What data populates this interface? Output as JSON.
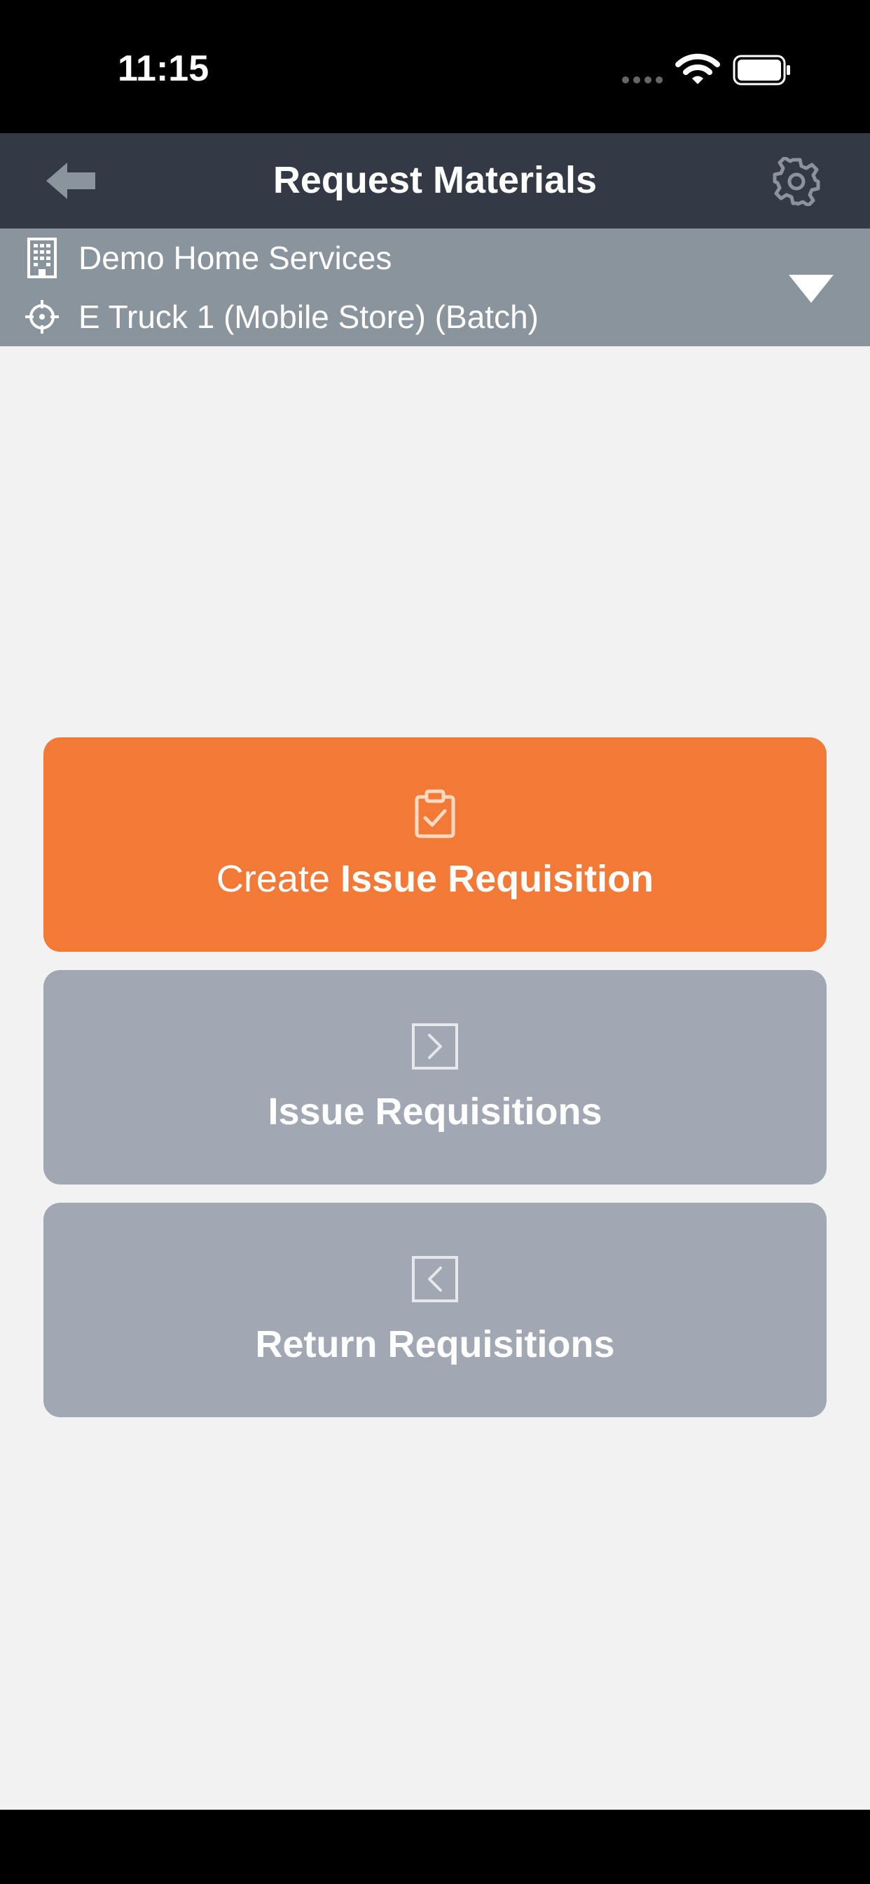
{
  "status_bar": {
    "time": "11:15",
    "icons": [
      "cellular-icon",
      "wifi-icon",
      "battery-icon"
    ]
  },
  "nav_bar": {
    "title": "Request Materials",
    "back_icon": "arrow-left-icon",
    "settings_icon": "gear-icon"
  },
  "location": {
    "company": "Demo Home Services",
    "company_icon": "building-icon",
    "store": "E Truck 1 (Mobile Store) (Batch)",
    "store_icon": "crosshair-icon",
    "dropdown_icon": "triangle-down-icon"
  },
  "actions": {
    "create": {
      "label_prefix": "Create ",
      "label_bold": "Issue Requisition",
      "icon": "clipboard-check-icon"
    },
    "issue": {
      "label": "Issue Requisitions",
      "icon": "chevron-right-box-icon"
    },
    "return": {
      "label": "Return Requisitions",
      "icon": "chevron-left-box-icon"
    }
  },
  "colors": {
    "status_bar_bg": "#000000",
    "nav_bar_bg": "#333a45",
    "location_bar_bg": "#8a949c",
    "page_bg": "#f2f2f2",
    "primary_button": "#f27a36",
    "secondary_button": "#a1a7b3",
    "text": "#ffffff"
  }
}
